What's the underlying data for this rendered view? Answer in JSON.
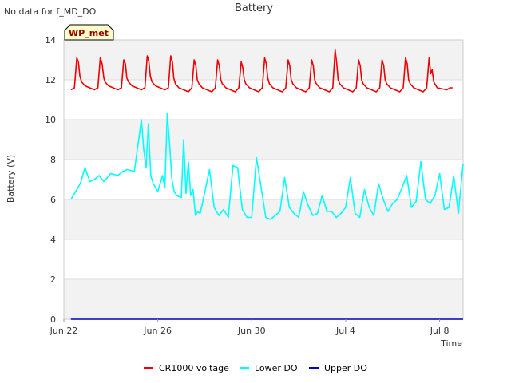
{
  "header": {
    "no_data_note": "No data for f_MD_DO"
  },
  "chart_data": {
    "type": "line",
    "title": "Battery",
    "xlabel": "Time",
    "ylabel": "Battery (V)",
    "site_badge": "WP_met",
    "xlim": [
      "2024-06-22",
      "2024-07-09"
    ],
    "ylim": [
      0,
      14
    ],
    "yticks": [
      0,
      2,
      4,
      6,
      8,
      10,
      12,
      14
    ],
    "xticks": [
      {
        "date": "2024-06-22",
        "label": "Jun 22"
      },
      {
        "date": "2024-06-26",
        "label": "Jun 26"
      },
      {
        "date": "2024-06-30",
        "label": "Jun 30"
      },
      {
        "date": "2024-07-04",
        "label": "Jul 4"
      },
      {
        "date": "2024-07-08",
        "label": "Jul 8"
      }
    ],
    "grid": true,
    "background_bands": true,
    "legend_position": "bottom",
    "x_start": "2024-06-22T00:00",
    "series": [
      {
        "name": "CR1000 voltage",
        "color": "#ee0000",
        "x_days": [
          0.3,
          0.45,
          0.55,
          0.62,
          0.68,
          0.75,
          0.9,
          1.3,
          1.45,
          1.55,
          1.63,
          1.7,
          1.75,
          1.9,
          2.3,
          2.45,
          2.55,
          2.62,
          2.68,
          2.75,
          2.9,
          3.3,
          3.45,
          3.55,
          3.62,
          3.68,
          3.75,
          3.9,
          4.3,
          4.45,
          4.55,
          4.62,
          4.68,
          4.75,
          4.9,
          5.3,
          5.45,
          5.55,
          5.62,
          5.68,
          5.75,
          5.9,
          6.3,
          6.45,
          6.55,
          6.62,
          6.68,
          6.75,
          6.9,
          7.3,
          7.45,
          7.55,
          7.62,
          7.68,
          7.75,
          7.9,
          8.3,
          8.45,
          8.55,
          8.62,
          8.68,
          8.75,
          8.9,
          9.3,
          9.45,
          9.55,
          9.62,
          9.68,
          9.75,
          9.9,
          10.3,
          10.45,
          10.55,
          10.62,
          10.68,
          10.75,
          10.9,
          11.3,
          11.45,
          11.55,
          11.62,
          11.68,
          11.75,
          11.9,
          12.3,
          12.45,
          12.55,
          12.62,
          12.68,
          12.75,
          12.9,
          13.3,
          13.45,
          13.55,
          13.62,
          13.68,
          13.75,
          13.9,
          14.3,
          14.45,
          14.55,
          14.62,
          14.68,
          14.75,
          14.9,
          15.3,
          15.45,
          15.55,
          15.62,
          15.68,
          15.75,
          15.9,
          16.3,
          16.45,
          16.55,
          16.62,
          16.68,
          16.75,
          16.9,
          17.0
        ],
        "values": [
          11.5,
          11.6,
          13.1,
          12.9,
          12.2,
          11.9,
          11.7,
          11.5,
          11.6,
          13.1,
          12.8,
          12.1,
          11.9,
          11.7,
          11.5,
          11.6,
          13.0,
          12.8,
          12.1,
          11.9,
          11.7,
          11.5,
          11.6,
          13.2,
          12.9,
          12.2,
          11.9,
          11.7,
          11.5,
          11.6,
          13.2,
          12.9,
          12.1,
          11.8,
          11.6,
          11.4,
          11.6,
          13.0,
          12.7,
          12.0,
          11.8,
          11.6,
          11.4,
          11.6,
          13.0,
          12.7,
          12.0,
          11.8,
          11.6,
          11.4,
          11.6,
          12.9,
          12.6,
          12.0,
          11.8,
          11.6,
          11.4,
          11.6,
          13.1,
          12.8,
          12.1,
          11.8,
          11.6,
          11.4,
          11.6,
          13.0,
          12.7,
          12.0,
          11.8,
          11.6,
          11.4,
          11.6,
          13.0,
          12.7,
          12.0,
          11.8,
          11.6,
          11.4,
          11.6,
          13.5,
          12.8,
          12.0,
          11.8,
          11.6,
          11.4,
          11.6,
          13.0,
          12.7,
          12.0,
          11.8,
          11.6,
          11.4,
          11.6,
          13.0,
          12.7,
          12.0,
          11.8,
          11.6,
          11.4,
          11.6,
          13.1,
          12.8,
          12.0,
          11.8,
          11.6,
          11.4,
          11.6,
          13.1,
          12.3,
          12.5,
          11.9,
          11.6,
          11.5,
          11.6,
          11.6
        ],
        "values_note": "",
        "x_last": 17.0
      },
      {
        "name": "Lower DO",
        "color": "#00ffff",
        "x_days": [
          0.3,
          0.5,
          0.7,
          0.9,
          1.1,
          1.3,
          1.5,
          1.7,
          2.0,
          2.3,
          2.5,
          2.7,
          3.0,
          3.3,
          3.4,
          3.5,
          3.6,
          3.7,
          3.8,
          4.0,
          4.2,
          4.3,
          4.4,
          4.5,
          4.6,
          4.7,
          4.8,
          5.0,
          5.1,
          5.2,
          5.3,
          5.4,
          5.5,
          5.6,
          5.7,
          5.8,
          5.9,
          6.2,
          6.4,
          6.6,
          6.8,
          7.0,
          7.2,
          7.4,
          7.6,
          7.8,
          8.0,
          8.2,
          8.4,
          8.6,
          8.8,
          9.0,
          9.2,
          9.4,
          9.6,
          9.8,
          10.0,
          10.2,
          10.4,
          10.6,
          10.8,
          11.0,
          11.2,
          11.4,
          11.6,
          11.8,
          12.0,
          12.2,
          12.4,
          12.6,
          12.8,
          13.0,
          13.2,
          13.4,
          13.6,
          13.8,
          14.0,
          14.2,
          14.4,
          14.6,
          14.8,
          15.0,
          15.2,
          15.4,
          15.6,
          15.8,
          16.0,
          16.2,
          16.4,
          16.6,
          16.8,
          17.0
        ],
        "values": [
          6.0,
          6.4,
          6.8,
          7.6,
          6.9,
          7.0,
          7.2,
          6.9,
          7.3,
          7.2,
          7.4,
          7.5,
          7.4,
          10.0,
          8.5,
          7.6,
          9.8,
          7.2,
          6.8,
          6.4,
          7.2,
          6.6,
          10.3,
          8.8,
          7.0,
          6.4,
          6.2,
          6.1,
          9.0,
          6.3,
          7.9,
          6.2,
          6.5,
          5.2,
          5.4,
          5.3,
          5.8,
          7.5,
          5.6,
          5.2,
          5.5,
          5.1,
          7.7,
          7.6,
          5.5,
          5.1,
          5.1,
          8.1,
          6.6,
          5.1,
          5.0,
          5.2,
          5.4,
          7.1,
          5.6,
          5.3,
          5.1,
          6.4,
          5.7,
          5.2,
          5.3,
          6.2,
          5.4,
          5.4,
          5.1,
          5.3,
          5.6,
          7.1,
          5.3,
          5.1,
          6.5,
          5.6,
          5.2,
          6.8,
          6.0,
          5.4,
          5.8,
          6.0,
          6.6,
          7.2,
          5.6,
          5.9,
          7.9,
          6.0,
          5.8,
          6.2,
          7.3,
          5.5,
          5.6,
          7.2,
          5.3,
          7.8
        ]
      },
      {
        "name": "Upper DO",
        "color": "#0000bb",
        "x_days": [
          0.3,
          17.0
        ],
        "values": [
          0.0,
          0.0
        ]
      }
    ]
  }
}
